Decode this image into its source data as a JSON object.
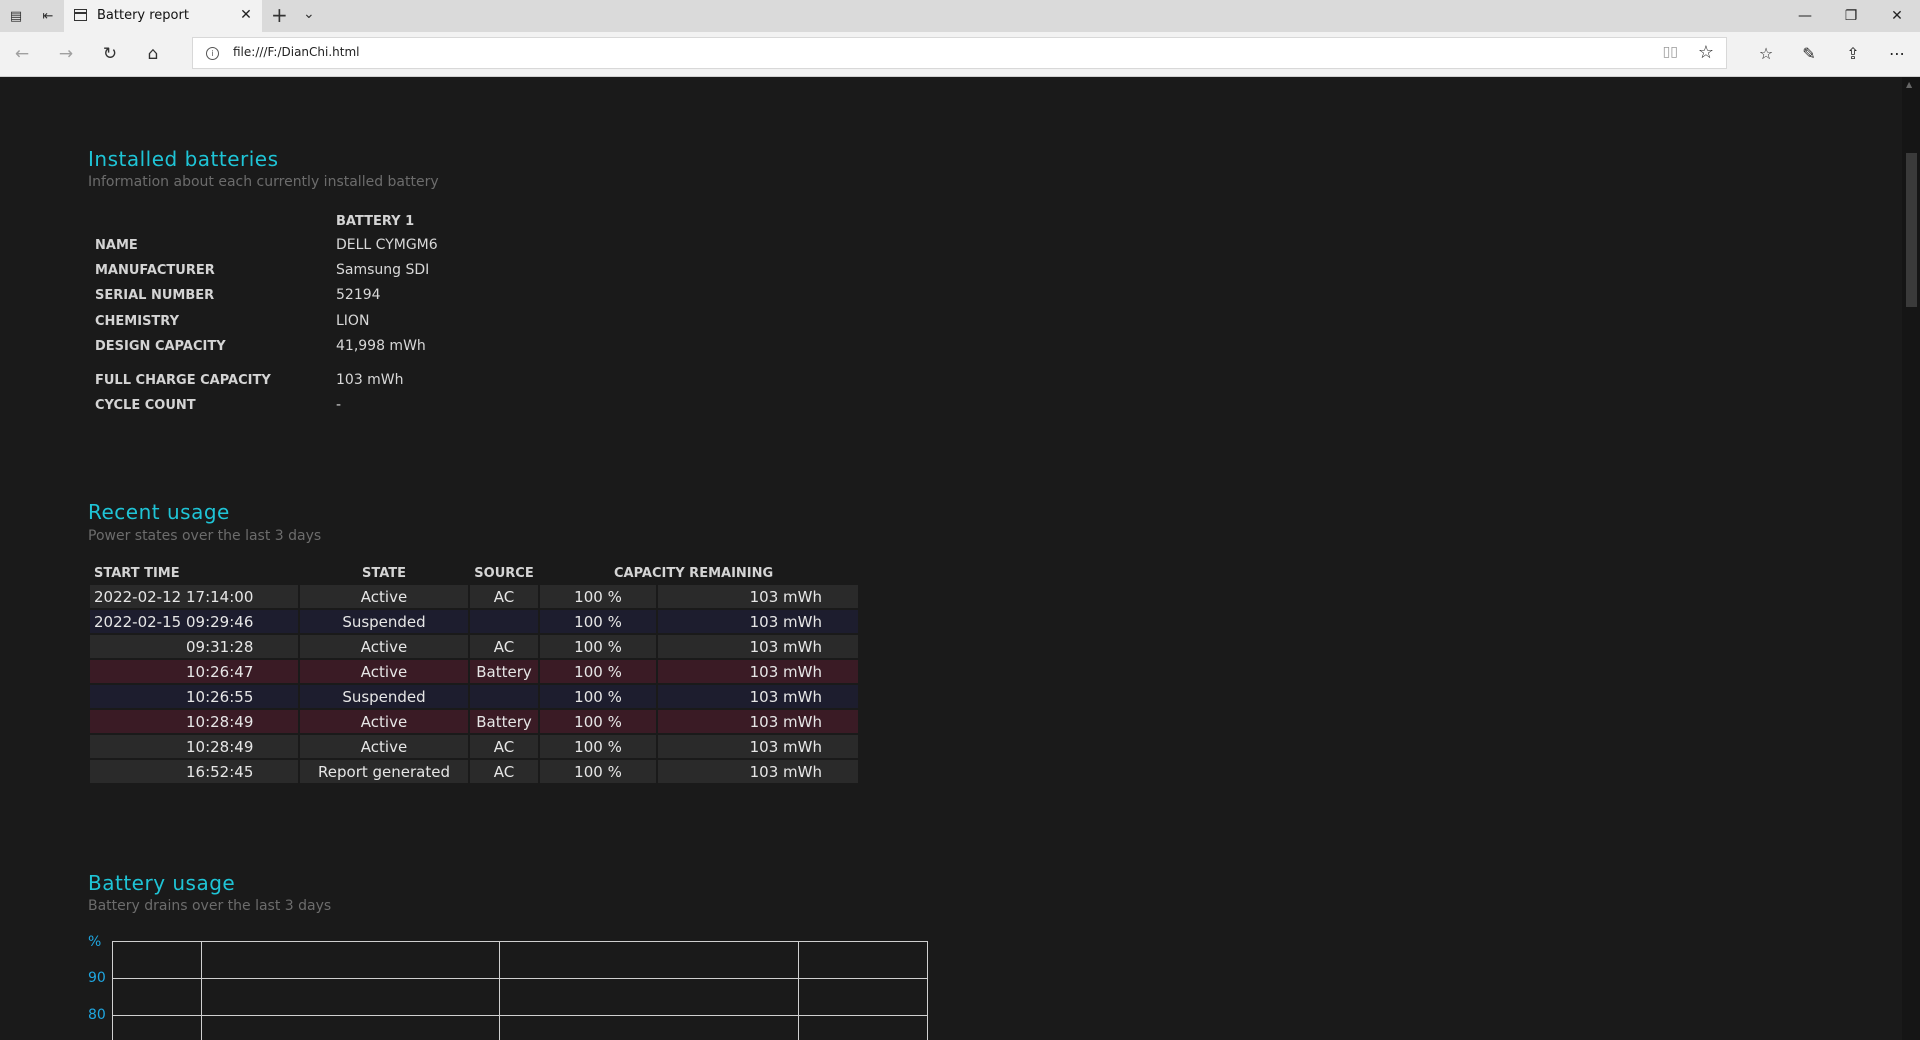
{
  "browser": {
    "tab_title": "Battery report",
    "url": "file:///F:/DianChi.html",
    "icons": [
      "tab-set-aside-icon",
      "tab-restore-icon",
      "page-icon",
      "close-icon",
      "new-tab-icon",
      "chevron-down-icon",
      "minimize-icon",
      "restore-icon",
      "window-close-icon",
      "back-icon",
      "forward-icon",
      "refresh-icon",
      "home-icon",
      "info-icon",
      "reading-view-icon",
      "favorite-star-icon",
      "favorites-hub-icon",
      "pen-icon",
      "share-icon",
      "more-icon"
    ]
  },
  "installed": {
    "title": "Installed batteries",
    "subtitle": "Information about each currently installed battery",
    "column_header": "BATTERY 1",
    "rows": [
      {
        "label": "NAME",
        "value": "DELL CYMGM6"
      },
      {
        "label": "MANUFACTURER",
        "value": "Samsung SDI"
      },
      {
        "label": "SERIAL NUMBER",
        "value": "52194"
      },
      {
        "label": "CHEMISTRY",
        "value": "LION"
      },
      {
        "label": "DESIGN CAPACITY",
        "value": "41,998 mWh"
      },
      {
        "label": "FULL CHARGE CAPACITY",
        "value": "103 mWh"
      },
      {
        "label": "CYCLE COUNT",
        "value": "-"
      }
    ]
  },
  "recent": {
    "title": "Recent usage",
    "subtitle": "Power states over the last 3 days",
    "headers": {
      "start_time": "START TIME",
      "state": "STATE",
      "source": "SOURCE",
      "capacity": "CAPACITY REMAINING"
    },
    "rows": [
      {
        "date": "2022-02-12",
        "time": "17:14:00",
        "state": "Active",
        "source": "AC",
        "percent": "100 %",
        "mwh": "103 mWh",
        "kind": "ac"
      },
      {
        "date": "2022-02-15",
        "time": "09:29:46",
        "state": "Suspended",
        "source": "",
        "percent": "100 %",
        "mwh": "103 mWh",
        "kind": "susp"
      },
      {
        "date": "",
        "time": "09:31:28",
        "state": "Active",
        "source": "AC",
        "percent": "100 %",
        "mwh": "103 mWh",
        "kind": "ac"
      },
      {
        "date": "",
        "time": "10:26:47",
        "state": "Active",
        "source": "Battery",
        "percent": "100 %",
        "mwh": "103 mWh",
        "kind": "batt"
      },
      {
        "date": "",
        "time": "10:26:55",
        "state": "Suspended",
        "source": "",
        "percent": "100 %",
        "mwh": "103 mWh",
        "kind": "susp"
      },
      {
        "date": "",
        "time": "10:28:49",
        "state": "Active",
        "source": "Battery",
        "percent": "100 %",
        "mwh": "103 mWh",
        "kind": "batt"
      },
      {
        "date": "",
        "time": "10:28:49",
        "state": "Active",
        "source": "AC",
        "percent": "100 %",
        "mwh": "103 mWh",
        "kind": "ac"
      },
      {
        "date": "",
        "time": "16:52:45",
        "state": "Report generated",
        "source": "AC",
        "percent": "100 %",
        "mwh": "103 mWh",
        "kind": "ac"
      }
    ]
  },
  "battery_usage": {
    "title": "Battery usage",
    "subtitle": "Battery drains over the last 3 days",
    "y_unit": "%",
    "y_ticks": [
      "90",
      "80"
    ]
  },
  "colors": {
    "heading": "#1fc4d6",
    "axis_label": "#1fa6e0",
    "row_ac": "#2a2a2a",
    "row_battery": "#3a1b25",
    "row_suspended": "#1d1d2e",
    "background": "#1a1a1a"
  }
}
